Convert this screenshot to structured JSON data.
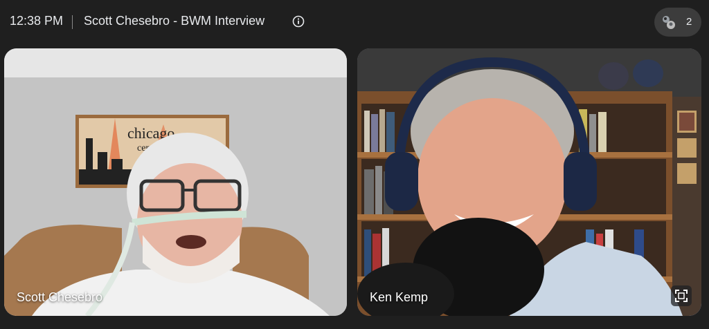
{
  "header": {
    "time": "12:38 PM",
    "meeting_title": "Scott Chesebro - BWM Interview",
    "info_icon": "info-icon",
    "participant_count": "2"
  },
  "poster_text": {
    "line1": "chicago",
    "line2": "cent"
  },
  "tiles": [
    {
      "name": "Scott Chesebro",
      "active_speaker": false
    },
    {
      "name": "Ken Kemp",
      "active_speaker": true,
      "fullscreen_icon": "fullscreen-icon"
    }
  ],
  "colors": {
    "background": "#1f1f1f",
    "active_border": "#a8c7fa",
    "pill": "#3c3c3c"
  }
}
